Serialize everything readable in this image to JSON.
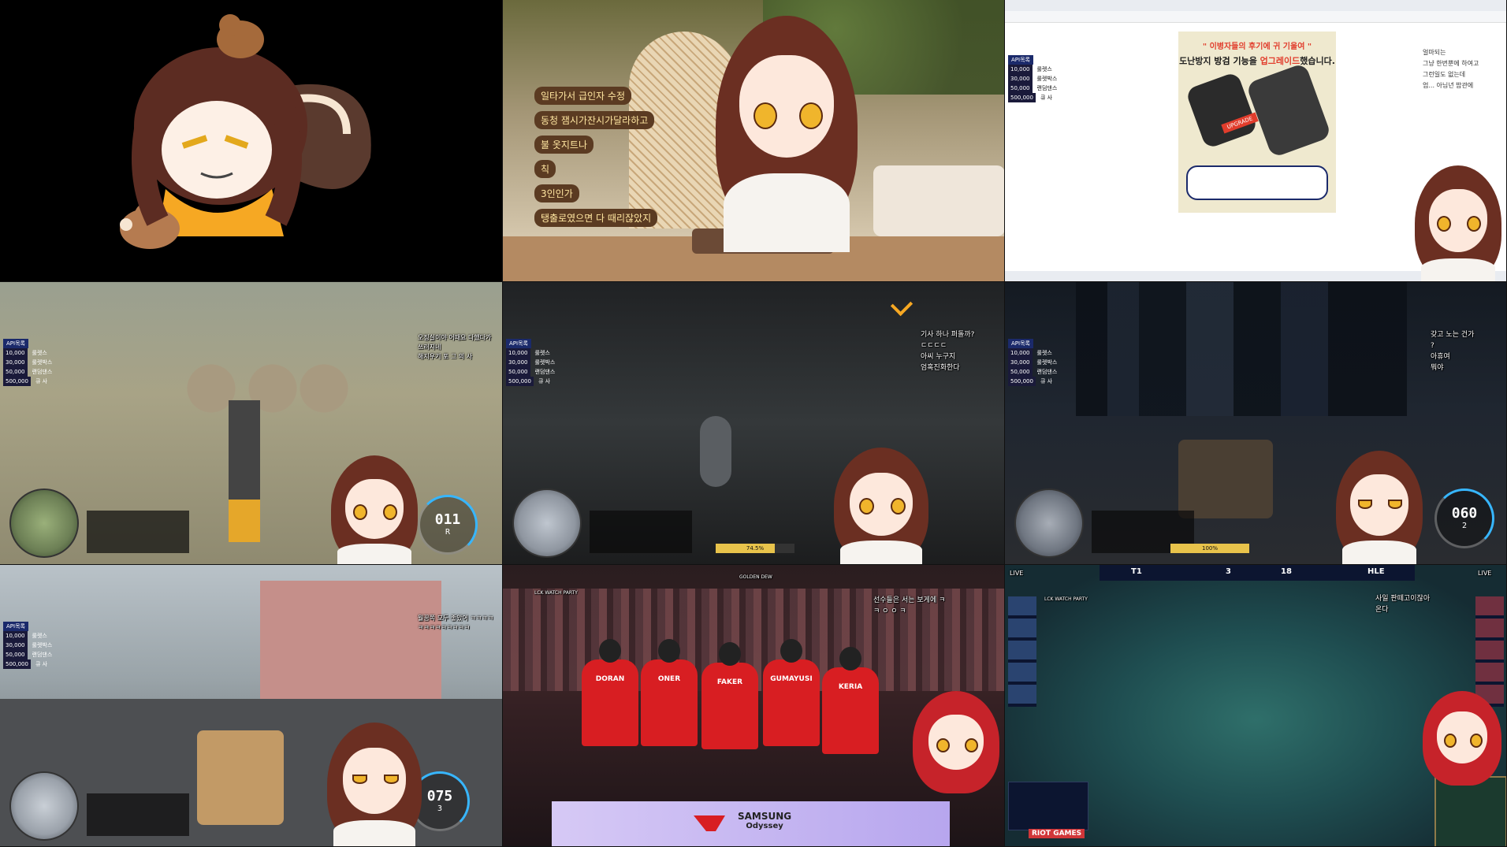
{
  "cell2": {
    "chat_lines": [
      "일타가서 급인자 수정",
      "동청 잼시가잔시가달라하고",
      "불 옷지트나",
      "칙",
      "3인인가",
      "탱출로였으면 다 때리잖았지"
    ]
  },
  "cell3": {
    "banner_line1": "\" 이병자들의 후기에 귀 기울여 \"",
    "banner_line2a": "도난방지 ",
    "banner_line2b": "방검 기능",
    "banner_line2c": "을 ",
    "banner_line2d": "업그레이드",
    "banner_line2e": "했습니다.",
    "badge": "UPGRADE",
    "side_chat": [
      "얼마되는",
      "그냥 한번뿐에 하여고",
      "그런일도 없는데",
      "엄... 아님년 밥관에"
    ]
  },
  "donations": {
    "title": "API목록",
    "rows": [
      {
        "amount": "10,000",
        "label": "룰렛스"
      },
      {
        "amount": "30,000",
        "label": "룰렛박스"
      },
      {
        "amount": "50,000",
        "label": "랜덤댄스"
      },
      {
        "amount": "500,000",
        "label": "큐 사"
      }
    ]
  },
  "cell4": {
    "chat": [
      "오징실이야 어때요 다했다가",
      "쓰러지네",
      "해지우기 포 그 의 사"
    ],
    "speed": "011",
    "gear": "R"
  },
  "cell5": {
    "chat": [
      "기사 하나 퍼돌까?",
      "ㄷㄷㄷㄷ",
      "아씨 누구지",
      "엄혹진화한다"
    ],
    "progress_label": "74.5%"
  },
  "cell6": {
    "chat": [
      "갖고 노는 건가",
      "?",
      "아휴여",
      "뭐야"
    ],
    "speed": "060",
    "gear": "2",
    "progress_label": "100%"
  },
  "cell7": {
    "chat": [
      "뭘꿈쪽 모두 좋았어 ㅋㅋㅋㅋ",
      "ㅋㅋㅋㅋㅋㅋㅋㅋㅋ"
    ],
    "speed": "075",
    "gear": "3"
  },
  "cell8": {
    "watch_label": "LCK WATCH PARTY",
    "sponsor1": "GOLDEN DEW",
    "chat": [
      "선수들은 서는 보게에 ㅋ",
      "ㅋ ㅇ ㅇ ㅋ"
    ],
    "players": [
      "DORAN",
      "ONER",
      "FAKER",
      "GUMAYUSI",
      "KERIA"
    ],
    "stage_brand1": "SAMSUNG",
    "stage_brand2": "Odyssey"
  },
  "cell9": {
    "live_left": "LIVE",
    "live_right": "LIVE",
    "team_left": "T1",
    "team_right": "HLE",
    "score_left": "3",
    "score_right": "18",
    "watch_label": "LCK WATCH PARTY",
    "chat": [
      "사일 판떼고이잖아",
      "온다"
    ],
    "riot": "RIOT GAMES"
  },
  "colors": {
    "t1_red": "#d81e22",
    "hair": "#6b2f22",
    "eye": "#f0b52c"
  }
}
